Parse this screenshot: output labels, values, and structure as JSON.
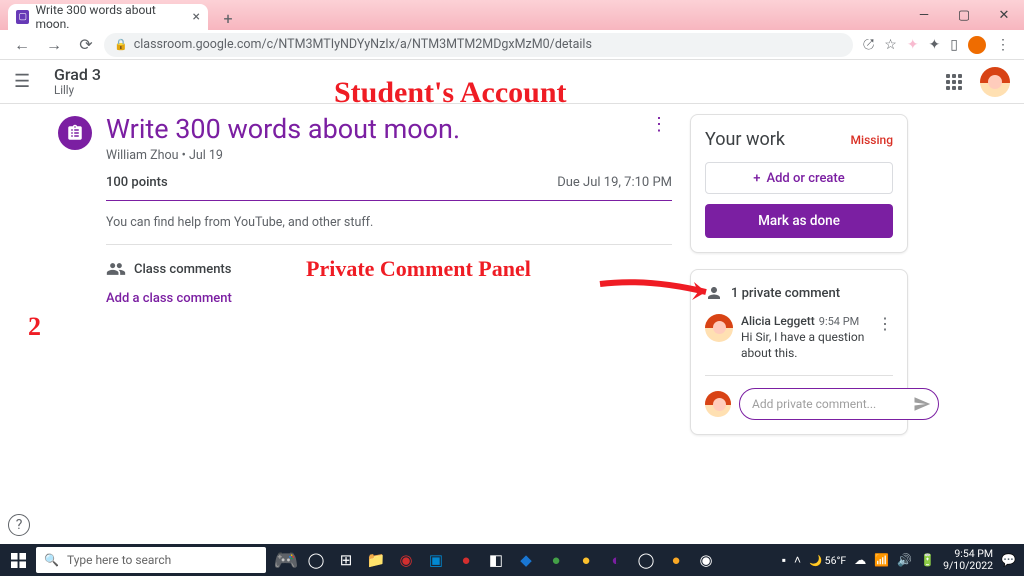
{
  "browser": {
    "tab_title": "Write 300 words about moon.",
    "url": "classroom.google.com/c/NTM3MTIyNDYyNzIx/a/NTM3MTM2MDgxMzM0/details"
  },
  "header": {
    "class_name": "Grad 3",
    "class_subtitle": "Lilly"
  },
  "assignment": {
    "title": "Write 300 words about moon.",
    "author": "William Zhou",
    "date": "Jul 19",
    "points": "100 points",
    "due": "Due Jul 19, 7:10 PM",
    "description": "You can find help from YouTube, and other stuff."
  },
  "class_comments": {
    "heading": "Class comments",
    "add": "Add a class comment"
  },
  "your_work": {
    "title": "Your work",
    "status": "Missing",
    "add_create": "Add or create",
    "mark_done": "Mark as done"
  },
  "private_comment": {
    "heading": "1 private comment",
    "author": "Alicia Leggett",
    "time": "9:54 PM",
    "text": "Hi Sir, I have a question about this.",
    "placeholder": "Add private comment..."
  },
  "annotations": {
    "title": "Student's Account",
    "panel": "Private Comment Panel",
    "number": "2"
  },
  "taskbar": {
    "search_placeholder": "Type here to search",
    "temp": "56°F",
    "time": "9:54 PM",
    "date": "9/10/2022"
  }
}
